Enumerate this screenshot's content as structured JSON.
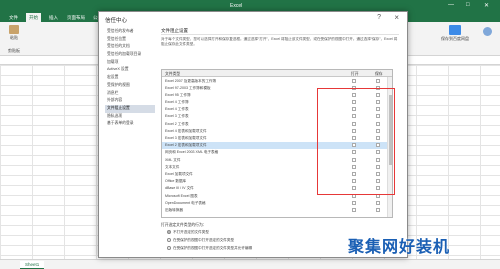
{
  "excel": {
    "window_title": "Excel",
    "tabs": [
      "文件",
      "开始",
      "插入",
      "页面布局",
      "公式",
      "数据",
      "审阅",
      "视图"
    ],
    "active_tab": "开始",
    "ribbon": {
      "paste_label": "粘贴",
      "clipboard_label": "剪贴板",
      "cloud_label": "保存到百度网盘"
    },
    "sheet_tab": "Sheet1"
  },
  "dialog": {
    "title": "信任中心",
    "help": "?",
    "close": "×",
    "nav_items": [
      "受信任的发布者",
      "受信任位置",
      "受信任的文档",
      "受信任的加载项目录",
      "加载项",
      "ActiveX 设置",
      "宏设置",
      "受保护的视图",
      "消息栏",
      "外部内容",
      "文件阻止设置",
      "隐私选项",
      "基于表单的登录",
      "",
      "",
      ""
    ],
    "selected_nav": "文件阻止设置",
    "pane": {
      "title": "文件阻止设置",
      "description": "对于每个文件类型，您可以选择打开和保存复选框。通过选择“打开”，Excel 将阻止该文件类型，或在受保护的视图中打开。通过选择“保存”，Excel 将阻止保存此文件类型。",
      "columns": {
        "file_type": "文件类型",
        "open": "打开",
        "save": "保存"
      },
      "rows": [
        "Excel 2007 及更高版本的工作簿",
        "Excel 97-2003 工作簿和模板",
        "Excel 95 工作簿",
        "Excel 4 工作簿",
        "Excel 4 工作表",
        "Excel 3 工作表",
        "Excel 2 工作表",
        "Excel 4 宏表和加载项文件",
        "Excel 3 宏表和加载项文件",
        "Excel 2 宏表和加载项文件",
        "网页和 Excel 2003 XML 电子表格",
        "XML 文件",
        "文本文件",
        "Excel 加载项文件",
        "Office 数据库",
        "dBase III / IV 文件",
        "Microsoft Excel 图表",
        "OpenDocument 电子表格",
        "旧版转换器"
      ],
      "selected_row": 9,
      "open_behavior_title": "打开选定文件类型的行为：",
      "radio_options": [
        "不打开选定的文件类型",
        "在受保护的视图中打开选定的文件类型",
        "在受保护的视图中打开选定的文件类型并允许编辑"
      ],
      "checked_radio": 0
    }
  },
  "watermark": {
    "text": "聚集网好装机"
  },
  "colors": {
    "excel_green": "#217346",
    "highlight": "#e63838",
    "selection": "#cde3f7"
  }
}
